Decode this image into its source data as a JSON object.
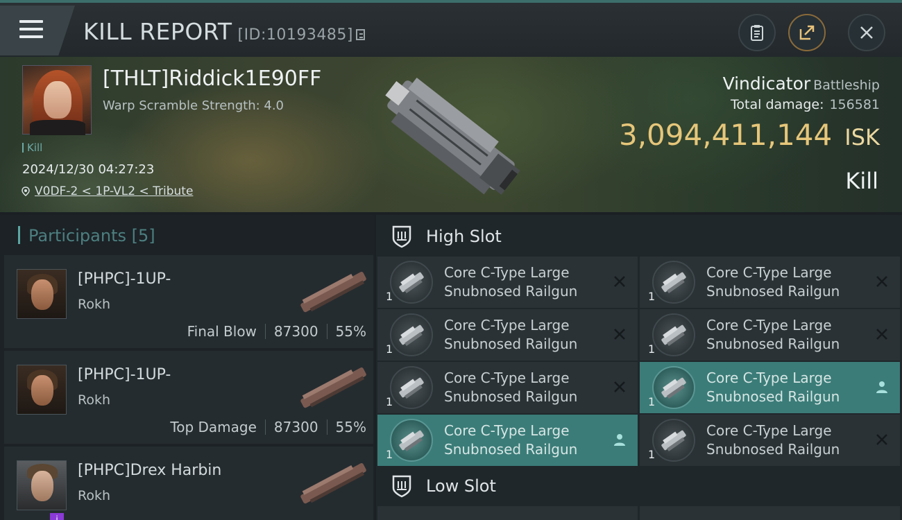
{
  "header": {
    "title": "KILL REPORT",
    "id_text": "[ID:10193485]"
  },
  "victim": {
    "name": "[THLT]Riddick1E90FF",
    "warp_scramble": "Warp Scramble Strength: 4.0",
    "tag": "Kill",
    "datetime": "2024/12/30 04:27:23",
    "location": "V0DF-2 < 1P-VL2 < Tribute",
    "ship_name": "Vindicator",
    "ship_class": "Battleship",
    "total_damage_label": "Total damage:",
    "total_damage": "156581",
    "isk_value": "3,094,411,144",
    "isk_unit": "ISK",
    "result": "Kill"
  },
  "participants": {
    "header": "Participants [5]",
    "rows": [
      {
        "name": "[PHPC]-1UP-",
        "ship": "Rokh",
        "role": "Final Blow",
        "damage": "87300",
        "percent": "55%"
      },
      {
        "name": "[PHPC]-1UP-",
        "ship": "Rokh",
        "role": "Top Damage",
        "damage": "87300",
        "percent": "55%"
      },
      {
        "name": "[PHPC]Drex Harbin",
        "ship": "Rokh",
        "role": "",
        "damage": "",
        "percent": ""
      }
    ]
  },
  "slots": {
    "high_label": "High Slot",
    "low_label": "Low Slot",
    "modules": [
      {
        "line1": "Core C-Type Large",
        "line2": "Snubnosed Railgun",
        "qty": "1",
        "state": "destroyed"
      },
      {
        "line1": "Core C-Type Large",
        "line2": "Snubnosed Railgun",
        "qty": "1",
        "state": "destroyed"
      },
      {
        "line1": "Core C-Type Large",
        "line2": "Snubnosed Railgun",
        "qty": "1",
        "state": "destroyed"
      },
      {
        "line1": "Core C-Type Large",
        "line2": "Snubnosed Railgun",
        "qty": "1",
        "state": "destroyed"
      },
      {
        "line1": "Core C-Type Large",
        "line2": "Snubnosed Railgun",
        "qty": "1",
        "state": "destroyed"
      },
      {
        "line1": "Core C-Type Large",
        "line2": "Snubnosed Railgun",
        "qty": "1",
        "state": "dropped"
      },
      {
        "line1": "Core C-Type Large",
        "line2": "Snubnosed Railgun",
        "qty": "1",
        "state": "dropped"
      },
      {
        "line1": "Core C-Type Large",
        "line2": "Snubnosed Railgun",
        "qty": "1",
        "state": "destroyed"
      }
    ]
  },
  "colors": {
    "accent": "#3b7c78",
    "isk": "#e6c67a",
    "participants_header": "#4d7f80"
  },
  "icons": [
    "menu-icon",
    "copy-icon",
    "clipboard-icon",
    "share-icon",
    "close-icon",
    "location-pin-icon",
    "shield-icon",
    "destroyed-x-icon",
    "dropped-person-icon",
    "info-icon"
  ]
}
